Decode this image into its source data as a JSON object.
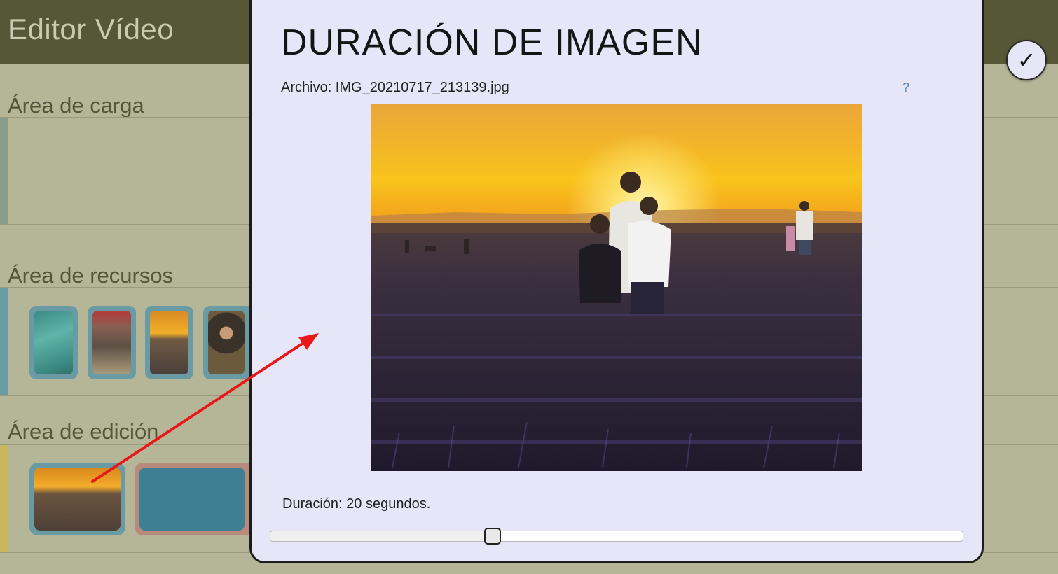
{
  "app": {
    "title": "Editor Vídeo"
  },
  "sections": {
    "upload_title": "Área de carga",
    "resources_title": "Área de recursos",
    "editing_title": "Área de edición"
  },
  "colors": {
    "topbar": "#565737",
    "background": "#b5b598",
    "modal_bg": "#e6e6f8",
    "resource_frame": "#6a9aa4",
    "edit_frame_image": "#6a9aa4",
    "edit_frame_video": "#b88a7c",
    "arrow": "#e81818"
  },
  "confirm_button": {
    "icon": "check-icon",
    "glyph": "✓"
  },
  "modal": {
    "title": "DURACIÓN DE IMAGEN",
    "file_label": "Archivo: IMG_20210717_213139.jpg",
    "help": "?",
    "duration_label": "Duración: 20 segundos.",
    "duration_slider_fraction": 0.325
  }
}
